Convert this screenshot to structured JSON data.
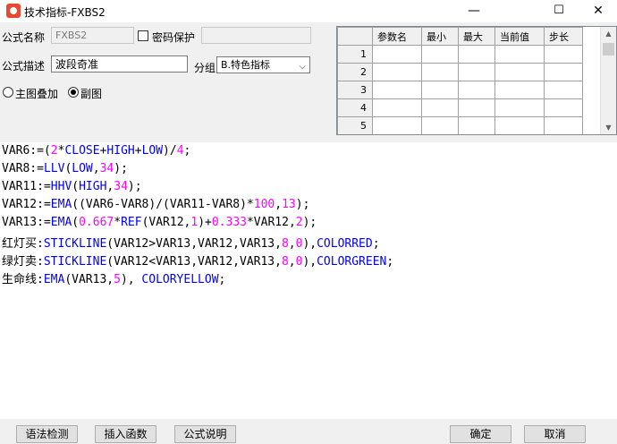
{
  "window": {
    "title": "技术指标-FXBS2",
    "minimize": "—",
    "maximize": "☐",
    "close": "✕"
  },
  "form": {
    "name_label": "公式名称",
    "name_value": "FXBS2",
    "password_label": "密码保护",
    "password_checked": false,
    "desc_label": "公式描述",
    "desc_value": "波段奇准",
    "group_label": "分组",
    "group_value": "B.特色指标",
    "radio_main": "主图叠加",
    "radio_sub": "副图",
    "selected_radio": "副图"
  },
  "param_table": {
    "columns": [
      "参数名",
      "最小",
      "最大",
      "当前值",
      "步长"
    ],
    "rows": [
      "1",
      "2",
      "3",
      "4",
      "5"
    ]
  },
  "code": [
    [
      [
        "t",
        "VAR6:=("
      ],
      [
        "n",
        "2"
      ],
      [
        "t",
        "*"
      ],
      [
        "f",
        "CLOSE"
      ],
      [
        "t",
        "+"
      ],
      [
        "f",
        "HIGH"
      ],
      [
        "t",
        "+"
      ],
      [
        "f",
        "LOW"
      ],
      [
        "t",
        ")/"
      ],
      [
        "n",
        "4"
      ],
      [
        "t",
        ";"
      ]
    ],
    [
      [
        "t",
        "VAR8:="
      ],
      [
        "f",
        "LLV"
      ],
      [
        "t",
        "("
      ],
      [
        "f",
        "LOW"
      ],
      [
        "t",
        ","
      ],
      [
        "n",
        "34"
      ],
      [
        "t",
        ");"
      ]
    ],
    [
      [
        "t",
        "VAR11:="
      ],
      [
        "f",
        "HHV"
      ],
      [
        "t",
        "("
      ],
      [
        "f",
        "HIGH"
      ],
      [
        "t",
        ","
      ],
      [
        "n",
        "34"
      ],
      [
        "t",
        ");"
      ]
    ],
    [
      [
        "t",
        "VAR12:="
      ],
      [
        "f",
        "EMA"
      ],
      [
        "t",
        "((VAR6-VAR8)/(VAR11-VAR8)*"
      ],
      [
        "n",
        "100"
      ],
      [
        "t",
        ","
      ],
      [
        "n",
        "13"
      ],
      [
        "t",
        ");"
      ]
    ],
    [
      [
        "t",
        "VAR13:="
      ],
      [
        "f",
        "EMA"
      ],
      [
        "t",
        "("
      ],
      [
        "n",
        "0.667"
      ],
      [
        "t",
        "*"
      ],
      [
        "f",
        "REF"
      ],
      [
        "t",
        "(VAR12,"
      ],
      [
        "n",
        "1"
      ],
      [
        "t",
        ")+"
      ],
      [
        "n",
        "0.333"
      ],
      [
        "t",
        "*VAR12,"
      ],
      [
        "n",
        "2"
      ],
      [
        "t",
        ");"
      ]
    ],
    [
      [
        "t",
        "红灯买:"
      ],
      [
        "f",
        "STICKLINE"
      ],
      [
        "t",
        "(VAR12>VAR13,VAR12,VAR13,"
      ],
      [
        "n",
        "8"
      ],
      [
        "t",
        ","
      ],
      [
        "n",
        "0"
      ],
      [
        "t",
        "),"
      ],
      [
        "f",
        "COLORRED"
      ],
      [
        "t",
        ";"
      ]
    ],
    [
      [
        "t",
        "绿灯卖:"
      ],
      [
        "f",
        "STICKLINE"
      ],
      [
        "t",
        "(VAR12<VAR13,VAR12,VAR13,"
      ],
      [
        "n",
        "8"
      ],
      [
        "t",
        ","
      ],
      [
        "n",
        "0"
      ],
      [
        "t",
        "),"
      ],
      [
        "f",
        "COLORGREEN"
      ],
      [
        "t",
        ";"
      ]
    ],
    [
      [
        "t",
        "生命线:"
      ],
      [
        "f",
        "EMA"
      ],
      [
        "t",
        "(VAR13,"
      ],
      [
        "n",
        "5"
      ],
      [
        "t",
        "), "
      ],
      [
        "f",
        "COLORYELLOW"
      ],
      [
        "t",
        ";"
      ]
    ]
  ],
  "buttons": {
    "syntax_check": "语法检测",
    "insert_function": "插入函数",
    "formula_help": "公式说明",
    "ok": "确定",
    "cancel": "取消"
  },
  "colors": {
    "function": "#0000ff",
    "number": "#ff00ff",
    "title_icon": "#e8492f"
  }
}
